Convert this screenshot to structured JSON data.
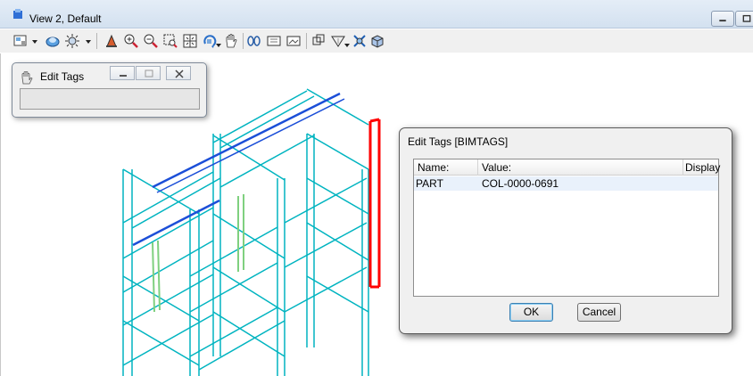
{
  "window": {
    "title": "View 2, Default"
  },
  "toolbar": {
    "icons": [
      "view-attributes-icon",
      "dropdown-arrow-icon",
      "display-style-icon",
      "render-icon",
      "dropdown-arrow-icon",
      "update-view-icon",
      "zoom-in-icon",
      "zoom-out-icon",
      "window-area-icon",
      "fit-view-icon",
      "rotate-view-icon",
      "pan-icon",
      "view-previous-icon",
      "view-next-icon",
      "copy-view-icon",
      "clip-volume-icon",
      "clip-mask-icon",
      "camera-icon",
      "view-settings-icon"
    ]
  },
  "small_window": {
    "title": "Edit Tags"
  },
  "dialog": {
    "title": "Edit Tags [BIMTAGS]",
    "columns": [
      "Name:",
      "Value:",
      "Display"
    ],
    "rows": [
      {
        "name": "PART",
        "value": "COL-0000-0691",
        "display": ""
      }
    ],
    "ok_label": "OK",
    "cancel_label": "Cancel"
  },
  "colors": {
    "structure": "#00b4c0",
    "highlight": "#ff0000",
    "beam_blue": "#1c4fd8",
    "brace_green": "#7fd07f"
  }
}
